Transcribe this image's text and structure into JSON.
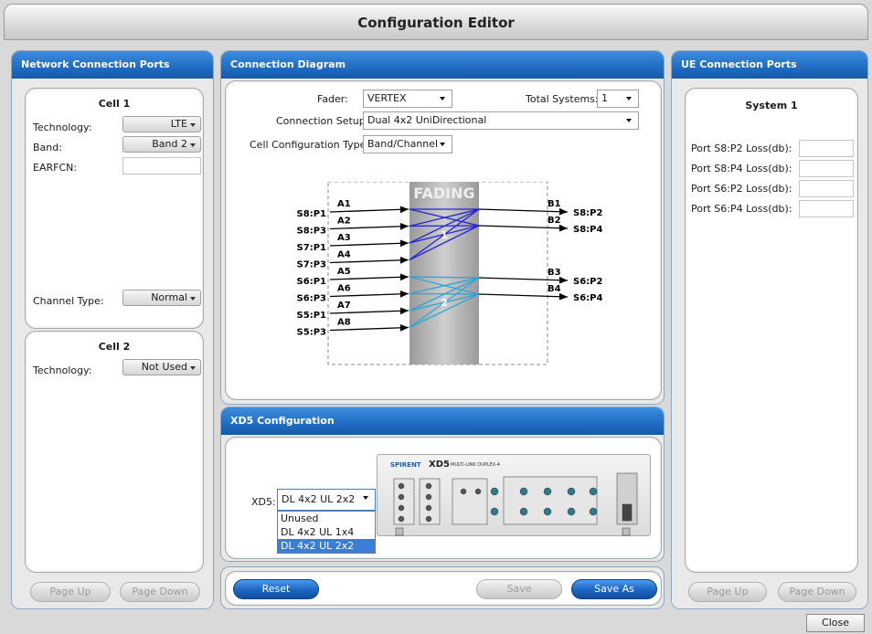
{
  "window": {
    "title": "Configuration Editor",
    "close_label": "Close"
  },
  "network_ports": {
    "header": "Network Connection Ports",
    "cell1": {
      "title": "Cell 1",
      "technology_label": "Technology:",
      "technology_value": "LTE",
      "band_label": "Band:",
      "band_value": "Band 2",
      "earfcn_label": "EARFCN:",
      "earfcn_value": "",
      "channel_type_label": "Channel Type:",
      "channel_type_value": "Normal"
    },
    "cell2": {
      "title": "Cell 2",
      "technology_label": "Technology:",
      "technology_value": "Not Used"
    },
    "page_up": "Page Up",
    "page_down": "Page Down"
  },
  "diagram": {
    "header": "Connection Diagram",
    "fader_label": "Fader:",
    "fader_value": "VERTEX",
    "total_systems_label": "Total Systems:",
    "total_systems_value": "1",
    "setup_label": "Connection Setup:",
    "setup_value": "Dual 4x2 UniDirectional",
    "cell_config_label": "Cell Configuration Type:",
    "cell_config_value": "Band/Channel",
    "fading_label": "FADING",
    "inputs": [
      {
        "port": "S8:P1",
        "id": "A1"
      },
      {
        "port": "S8:P3",
        "id": "A2"
      },
      {
        "port": "S7:P1",
        "id": "A3"
      },
      {
        "port": "S7:P3",
        "id": "A4"
      },
      {
        "port": "S6:P1",
        "id": "A5"
      },
      {
        "port": "S6:P3",
        "id": "A6"
      },
      {
        "port": "S5:P1",
        "id": "A7"
      },
      {
        "port": "S5:P3",
        "id": "A8"
      }
    ],
    "outputs": [
      {
        "id": "B1",
        "port": "S8:P2"
      },
      {
        "id": "B2",
        "port": "S8:P4"
      },
      {
        "id": "B3",
        "port": "S6:P2"
      },
      {
        "id": "B4",
        "port": "S6:P4"
      }
    ],
    "group_labels": [
      "1",
      "2"
    ],
    "colors": {
      "group1": "#2424d8",
      "group2": "#2aa6d6"
    }
  },
  "xd5": {
    "header": "XD5 Configuration",
    "label": "XD5:",
    "value": "DL 4x2 UL 2x2",
    "options": [
      "Unused",
      "DL 4x2 UL 1x4",
      "DL 4x2 UL 2x2"
    ],
    "selected_index": 2,
    "device_brand": "SPIRENT",
    "device_model": "XD5",
    "device_subtitle": "MULTI-LINK DUPLEX-4"
  },
  "actions": {
    "reset": "Reset",
    "save": "Save",
    "save_as": "Save As"
  },
  "ue_ports": {
    "header": "UE Connection Ports",
    "system_title": "System 1",
    "ports": [
      {
        "label": "Port S8:P2 Loss(db):",
        "value": ""
      },
      {
        "label": "Port S8:P4 Loss(db):",
        "value": ""
      },
      {
        "label": "Port S6:P2 Loss(db):",
        "value": ""
      },
      {
        "label": "Port S6:P4 Loss(db):",
        "value": ""
      }
    ],
    "page_up": "Page Up",
    "page_down": "Page Down"
  }
}
